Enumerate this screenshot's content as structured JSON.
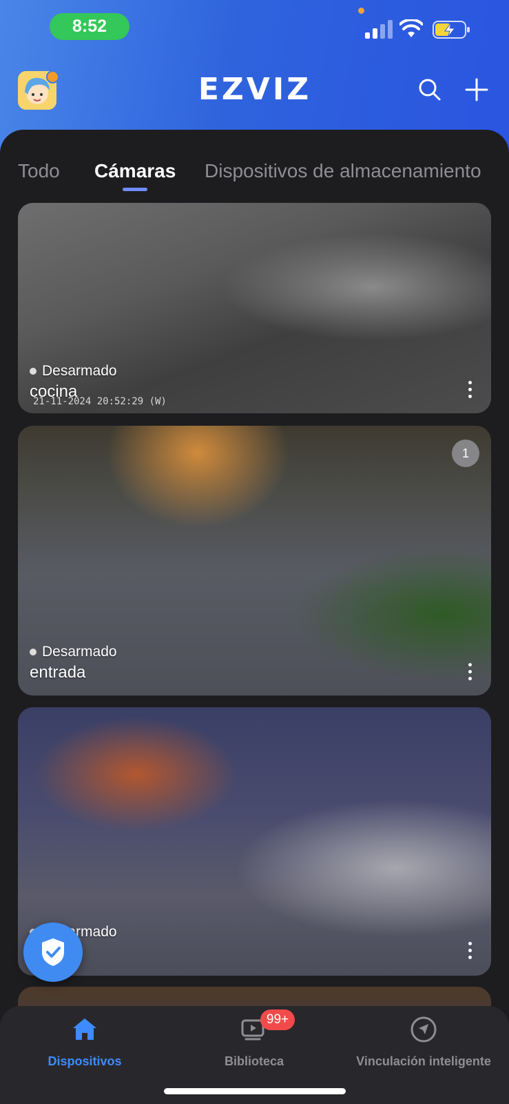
{
  "status_bar": {
    "time": "8:52"
  },
  "header": {
    "logo": "EZVIZ"
  },
  "tabs": [
    {
      "label": "Todo"
    },
    {
      "label": "Cámaras"
    },
    {
      "label": "Dispositivos de almacenamiento"
    }
  ],
  "cameras": [
    {
      "name": "cocina",
      "status": "Desarmado",
      "timestamp": "21-11-2024 20:52:29  (W)"
    },
    {
      "name": "entrada",
      "status": "Desarmado",
      "event_count": "1"
    },
    {
      "status": "Desarmado"
    }
  ],
  "bottom_nav": {
    "items": [
      {
        "label": "Dispositivos",
        "icon": "home-icon"
      },
      {
        "label": "Biblioteca",
        "icon": "library-icon",
        "badge": "99+"
      },
      {
        "label": "Vinculación inteligente",
        "icon": "compass-icon"
      }
    ]
  },
  "colors": {
    "header_gradient_start": "#4a86e8",
    "header_gradient_end": "#2a55e0",
    "accent": "#3d8bff",
    "status_pill": "#34c759",
    "badge": "#f24a4a"
  }
}
